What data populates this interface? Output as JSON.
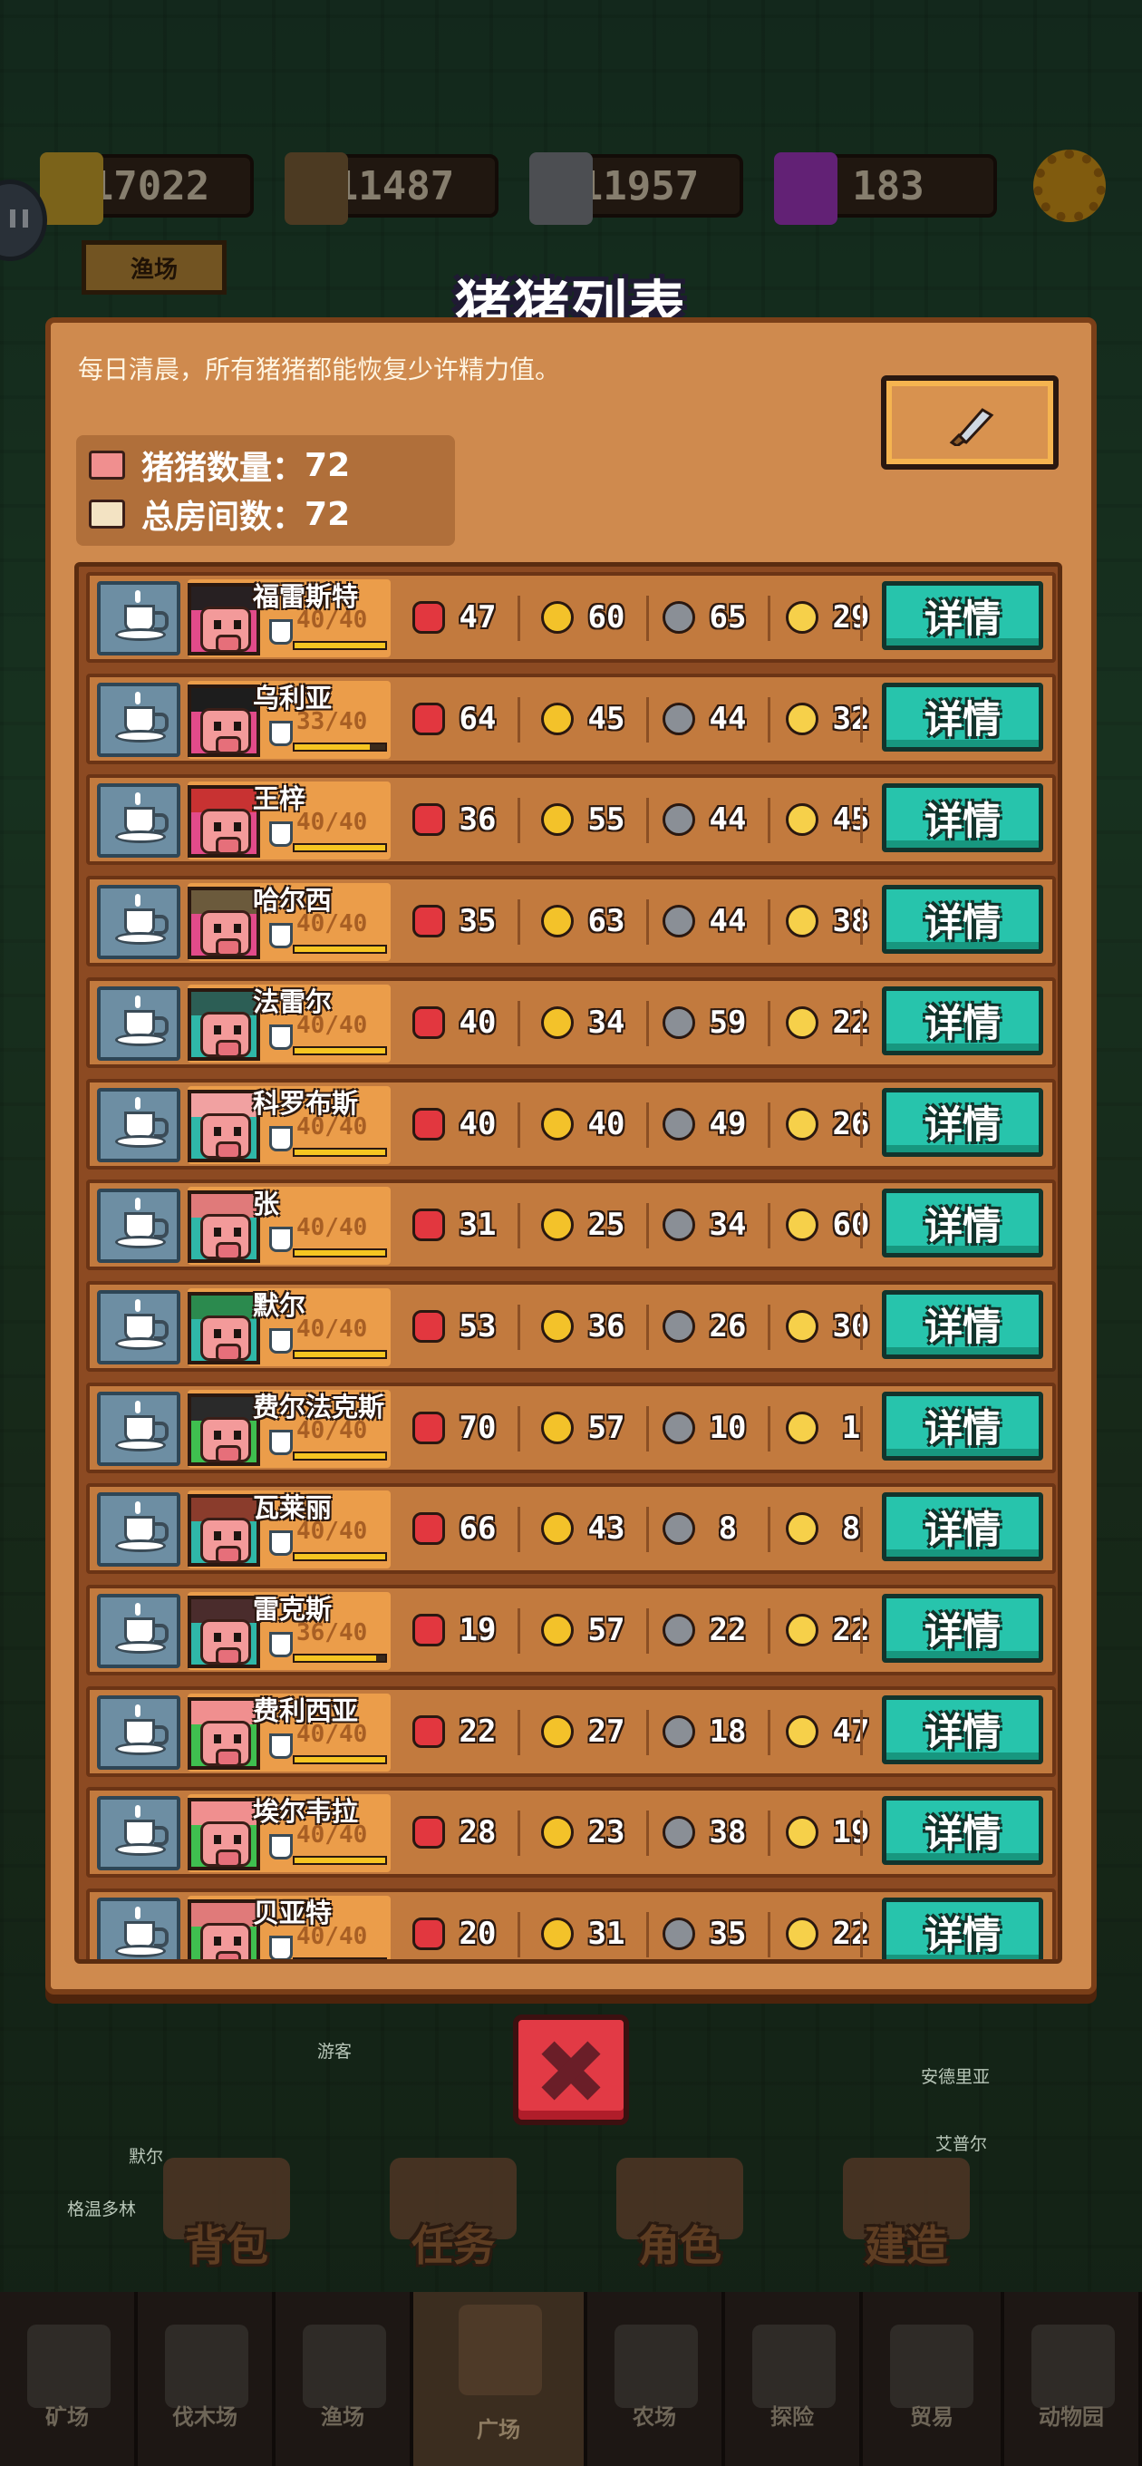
{
  "resources": [
    {
      "name": "gold",
      "value": "17022",
      "color": "#e0b430"
    },
    {
      "name": "wood",
      "value": "11487",
      "color": "#8a6a3e"
    },
    {
      "name": "stone",
      "value": "11957",
      "color": "#8a8f96"
    },
    {
      "name": "gem",
      "value": "183",
      "color": "#b23dd6"
    }
  ],
  "background": {
    "signboard": "渔场",
    "names": [
      "游客",
      "默尔",
      "格温多林",
      "艾普尔",
      "安德里亚"
    ]
  },
  "dialog": {
    "title": "猪猪列表",
    "notice": "每日清晨，所有猪猪都能恢复少许精力值。",
    "pig_count_label": "猪猪数量：",
    "pig_count": "72",
    "room_count_label": "总房间数：",
    "room_count": "72",
    "detail_label": "详情"
  },
  "pigs": [
    {
      "name": "福雷斯特",
      "energy": "40/40",
      "e": 1.0,
      "str": "47",
      "int": "60",
      "craft": "65",
      "luck": "29",
      "bg": "#e24b8a",
      "hair": "#272022"
    },
    {
      "name": "乌利亚",
      "energy": "33/40",
      "e": 0.825,
      "str": "64",
      "int": "45",
      "craft": "44",
      "luck": "32",
      "bg": "#e24b8a",
      "hair": "#1d1d1d"
    },
    {
      "name": "王梓",
      "energy": "40/40",
      "e": 1.0,
      "str": "36",
      "int": "55",
      "craft": "44",
      "luck": "45",
      "bg": "#e24b8a",
      "hair": "#c83232"
    },
    {
      "name": "哈尔西",
      "energy": "40/40",
      "e": 1.0,
      "str": "35",
      "int": "63",
      "craft": "44",
      "luck": "38",
      "bg": "#e24b8a",
      "hair": "#6b5a3c"
    },
    {
      "name": "法雷尔",
      "energy": "40/40",
      "e": 1.0,
      "str": "40",
      "int": "34",
      "craft": "59",
      "luck": "22",
      "bg": "#2fb7a8",
      "hair": "#2c5e55"
    },
    {
      "name": "科罗布斯",
      "energy": "40/40",
      "e": 1.0,
      "str": "40",
      "int": "40",
      "craft": "49",
      "luck": "26",
      "bg": "#2fb7a8",
      "hair": "#f1a1a1"
    },
    {
      "name": "张",
      "energy": "40/40",
      "e": 1.0,
      "str": "31",
      "int": "25",
      "craft": "34",
      "luck": "60",
      "bg": "#2fb7a8",
      "hair": "#e07a7a"
    },
    {
      "name": "默尔",
      "energy": "40/40",
      "e": 1.0,
      "str": "53",
      "int": "36",
      "craft": "26",
      "luck": "30",
      "bg": "#2fb7a8",
      "hair": "#2b8a4e"
    },
    {
      "name": "费尔法克斯",
      "energy": "40/40",
      "e": 1.0,
      "str": "70",
      "int": "57",
      "craft": "10",
      "luck": "1",
      "bg": "#3fbf4f",
      "hair": "#2a2a2a"
    },
    {
      "name": "瓦莱丽",
      "energy": "40/40",
      "e": 1.0,
      "str": "66",
      "int": "43",
      "craft": "8",
      "luck": "8",
      "bg": "#2fb7a8",
      "hair": "#8a3c2c"
    },
    {
      "name": "雷克斯",
      "energy": "36/40",
      "e": 0.9,
      "str": "19",
      "int": "57",
      "craft": "22",
      "luck": "22",
      "bg": "#2fb7a8",
      "hair": "#4a2c2c"
    },
    {
      "name": "费利西亚",
      "energy": "40/40",
      "e": 1.0,
      "str": "22",
      "int": "27",
      "craft": "18",
      "luck": "47",
      "bg": "#3fbf4f",
      "hair": "#f08f8f"
    },
    {
      "name": "埃尔韦拉",
      "energy": "40/40",
      "e": 1.0,
      "str": "28",
      "int": "23",
      "craft": "38",
      "luck": "19",
      "bg": "#3fbf4f",
      "hair": "#f08f8f"
    },
    {
      "name": "贝亚特",
      "energy": "40/40",
      "e": 1.0,
      "str": "20",
      "int": "31",
      "craft": "35",
      "luck": "22",
      "bg": "#3fbf4f",
      "hair": "#e07a7a"
    }
  ],
  "menu": [
    "背包",
    "任务",
    "角色",
    "建造"
  ],
  "nav": [
    {
      "label": "矿场",
      "active": false
    },
    {
      "label": "伐木场",
      "active": false
    },
    {
      "label": "渔场",
      "active": false
    },
    {
      "label": "广场",
      "active": true
    },
    {
      "label": "农场",
      "active": false
    },
    {
      "label": "探险",
      "active": false
    },
    {
      "label": "贸易",
      "active": false
    },
    {
      "label": "动物园",
      "active": false
    }
  ],
  "colors": {
    "panel": "#cf8a4e",
    "detail": "#27c4ac",
    "close": "#e23a45",
    "energy_bar": "#f6c521"
  }
}
